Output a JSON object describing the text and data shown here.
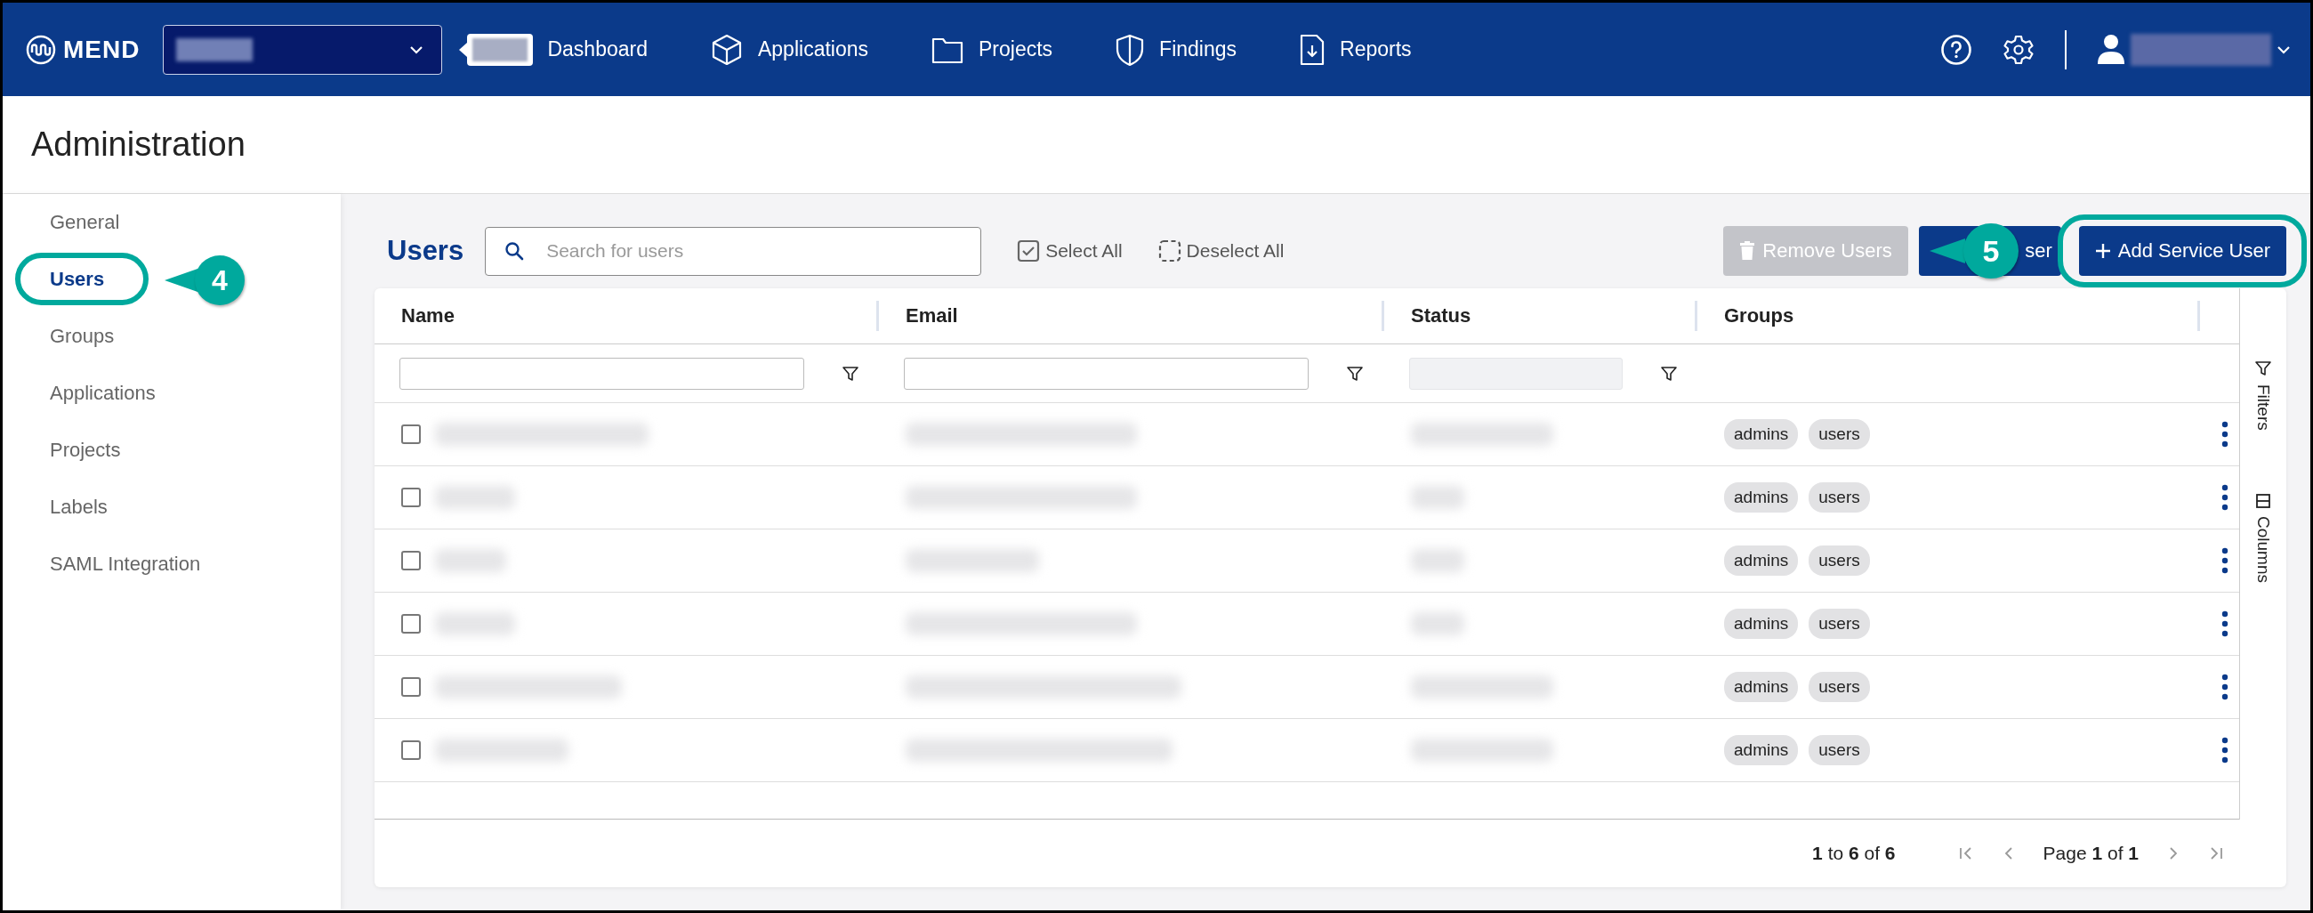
{
  "topbar": {
    "brand": "MEND",
    "nav": [
      {
        "label": "Dashboard"
      },
      {
        "label": "Applications"
      },
      {
        "label": "Projects"
      },
      {
        "label": "Findings"
      },
      {
        "label": "Reports"
      }
    ]
  },
  "page_title": "Administration",
  "sidebar": {
    "items": [
      {
        "label": "General",
        "selected": false
      },
      {
        "label": "Users",
        "selected": true
      },
      {
        "label": "Groups",
        "selected": false
      },
      {
        "label": "Applications",
        "selected": false
      },
      {
        "label": "Projects",
        "selected": false
      },
      {
        "label": "Labels",
        "selected": false
      },
      {
        "label": "SAML Integration",
        "selected": false
      }
    ]
  },
  "users_panel": {
    "title": "Users",
    "search": {
      "placeholder": "Search for users"
    },
    "select_all": "Select All",
    "deselect_all": "Deselect All",
    "buttons": [
      {
        "label": "Remove Users",
        "kind": "remove",
        "disabled": true
      },
      {
        "label": "ser",
        "kind": "plain",
        "disabled": false
      },
      {
        "label": "Add Service User",
        "kind": "add",
        "disabled": false
      }
    ]
  },
  "table": {
    "columns": [
      {
        "label": "Name",
        "kind": "filterable"
      },
      {
        "label": "Email",
        "kind": "filterable"
      },
      {
        "label": "Status",
        "kind": "locked"
      },
      {
        "label": "Groups",
        "kind": "plain"
      }
    ],
    "rows": [
      {
        "checked": false,
        "groups": [
          "admins",
          "users"
        ]
      },
      {
        "checked": false,
        "groups": [
          "admins",
          "users"
        ]
      },
      {
        "checked": false,
        "groups": [
          "admins",
          "users"
        ]
      },
      {
        "checked": false,
        "groups": [
          "admins",
          "users"
        ]
      },
      {
        "checked": false,
        "groups": [
          "admins",
          "users"
        ]
      },
      {
        "checked": false,
        "groups": [
          "admins",
          "users"
        ]
      }
    ]
  },
  "side_panel": [
    "Filters",
    "Columns"
  ],
  "pagination": {
    "range": "**1** to **6** of **6**",
    "page": "Page **1** of **1**"
  },
  "callouts": [
    {
      "number": "4"
    },
    {
      "number": "5"
    }
  ]
}
